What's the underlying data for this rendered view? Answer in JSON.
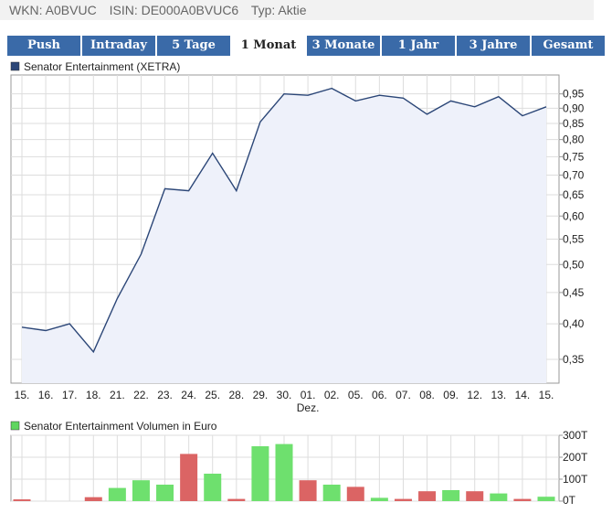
{
  "info": {
    "wkn": "WKN: A0BVUC",
    "isin": "ISIN: DE000A0BVUC6",
    "typ": "Typ: Aktie"
  },
  "tabs": [
    {
      "label": "Push",
      "active": false
    },
    {
      "label": "Intraday",
      "active": false
    },
    {
      "label": "5 Tage",
      "active": false
    },
    {
      "label": "1 Monat",
      "active": true
    },
    {
      "label": "3 Monate",
      "active": false
    },
    {
      "label": "1 Jahr",
      "active": false
    },
    {
      "label": "3 Jahre",
      "active": false
    },
    {
      "label": "Gesamt",
      "active": false
    }
  ],
  "colors": {
    "tab_bg": "#3a6aa8",
    "price_line": "#2b4677",
    "price_fill": "#eef1fa",
    "legend_price": "#2b4677",
    "legend_volume": "#5fd65f",
    "vol_up": "#6ee06e",
    "vol_down": "#db6464"
  },
  "chart_data": [
    {
      "type": "line",
      "legend": "Senator Entertainment (XETRA)",
      "x": [
        "15.",
        "16.",
        "17.",
        "18.",
        "21.",
        "22.",
        "23.",
        "24.",
        "25.",
        "28.",
        "29.",
        "30.",
        "01.",
        "02.",
        "05.",
        "06.",
        "07.",
        "08.",
        "09.",
        "12.",
        "13.",
        "14.",
        "15."
      ],
      "month_label": "Dez.",
      "month_label_at": 12,
      "values": [
        0.395,
        0.39,
        0.4,
        0.36,
        0.44,
        0.52,
        0.665,
        0.66,
        0.76,
        0.66,
        0.855,
        0.95,
        0.945,
        0.97,
        0.925,
        0.945,
        0.935,
        0.88,
        0.925,
        0.905,
        0.94,
        0.875,
        0.905
      ],
      "y_ticks": [
        "0,35",
        "0,40",
        "0,45",
        "0,50",
        "0,55",
        "0,60",
        "0,65",
        "0,70",
        "0,75",
        "0,80",
        "0,85",
        "0,90",
        "0,95"
      ],
      "y_tick_values": [
        0.35,
        0.4,
        0.45,
        0.5,
        0.55,
        0.6,
        0.65,
        0.7,
        0.75,
        0.8,
        0.85,
        0.9,
        0.95
      ],
      "y_scale": "log",
      "ylim": [
        0.32,
        1.02
      ],
      "grid": true
    },
    {
      "type": "bar",
      "legend": "Senator Entertainment Volumen in Euro",
      "values": [
        8,
        0,
        0,
        18,
        60,
        95,
        75,
        215,
        125,
        10,
        250,
        260,
        95,
        75,
        65,
        15,
        10,
        45,
        50,
        45,
        35,
        10,
        20
      ],
      "direction": [
        "down",
        "none",
        "none",
        "down",
        "up",
        "up",
        "up",
        "down",
        "up",
        "down",
        "up",
        "up",
        "down",
        "up",
        "down",
        "up",
        "down",
        "down",
        "up",
        "down",
        "up",
        "down",
        "up"
      ],
      "y_ticks": [
        "0T",
        "100T",
        "200T",
        "300T"
      ],
      "y_tick_values": [
        0,
        100,
        200,
        300
      ],
      "ylim": [
        0,
        300
      ],
      "grid": true
    }
  ]
}
